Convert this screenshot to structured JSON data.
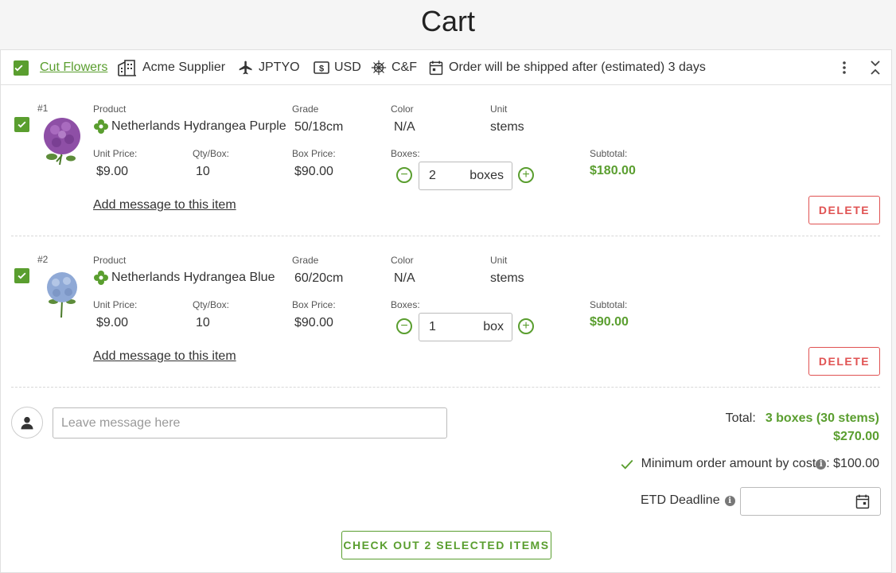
{
  "page": {
    "title": "Cart"
  },
  "header": {
    "category": "Cut Flowers",
    "supplier": "Acme Supplier",
    "airport": "JPTYO",
    "currency": "USD",
    "incoterm": "C&F",
    "shipping_note": "Order will be shipped after (estimated) 3 days",
    "icons": {
      "more": "more-vert-icon",
      "collapse": "collapse-icon"
    }
  },
  "labels": {
    "product": "Product",
    "grade": "Grade",
    "color": "Color",
    "unit": "Unit",
    "unit_price": "Unit Price:",
    "qty_box": "Qty/Box:",
    "box_price": "Box Price:",
    "boxes": "Boxes:",
    "subtotal": "Subtotal:",
    "add_message": "Add message to this item",
    "delete": "DELETE"
  },
  "items": [
    {
      "index": "#1",
      "product": "Netherlands Hydrangea Purple",
      "grade": "50/18cm",
      "color": "N/A",
      "unit": "stems",
      "unit_price": "$9.00",
      "qty_per_box": "10",
      "box_price": "$90.00",
      "boxes": "2",
      "box_unit": "boxes",
      "subtotal": "$180.00",
      "image_color": "#8e4fa6"
    },
    {
      "index": "#2",
      "product": "Netherlands Hydrangea Blue",
      "grade": "60/20cm",
      "color": "N/A",
      "unit": "stems",
      "unit_price": "$9.00",
      "qty_per_box": "10",
      "box_price": "$90.00",
      "boxes": "1",
      "box_unit": "box",
      "subtotal": "$90.00",
      "image_color": "#8fa9d6"
    }
  ],
  "footer": {
    "message_placeholder": "Leave message here",
    "total_label": "Total:",
    "total_boxes": "3 boxes (30 stems)",
    "total_amount": "$270.00",
    "min_order_label": "Minimum order amount by cost",
    "min_order_value": ": $100.00",
    "etd_label": "ETD Deadline",
    "checkout_label": "CHECK OUT 2 SELECTED ITEMS"
  },
  "colors": {
    "accent": "#5a9e2f",
    "danger": "#e05252"
  }
}
